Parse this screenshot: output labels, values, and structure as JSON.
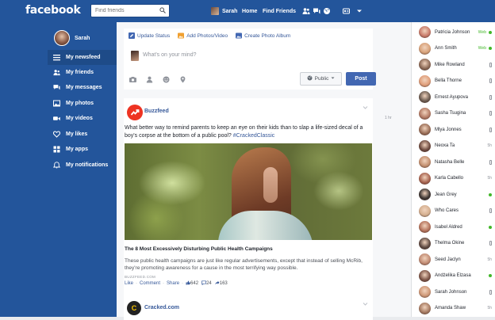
{
  "topbar": {
    "logo": "facebook",
    "search_placeholder": "Find friends",
    "user_name": "Sarah",
    "home": "Home",
    "find_friends": "Find Friends"
  },
  "sidebar": {
    "user_name": "Sarah",
    "items": [
      {
        "label": "My newsfeed",
        "icon": "list-icon"
      },
      {
        "label": "My friends",
        "icon": "friends-icon"
      },
      {
        "label": "My messages",
        "icon": "messages-icon"
      },
      {
        "label": "My photos",
        "icon": "photo-icon"
      },
      {
        "label": "My videos",
        "icon": "video-icon"
      },
      {
        "label": "My likes",
        "icon": "heart-icon"
      },
      {
        "label": "My apps",
        "icon": "apps-icon"
      },
      {
        "label": "My notifications",
        "icon": "bell-icon"
      }
    ]
  },
  "composer": {
    "tabs": [
      "Update Status",
      "Add Photos/Video",
      "Create Photo Album"
    ],
    "placeholder": "What's on your mind?",
    "privacy": "Public",
    "post_label": "Post"
  },
  "post": {
    "author": "Buzzfeed",
    "text": "What better way to remind parents to keep an eye on their kids than to slap a life-sized decal of a boy's corpse at the bottom of a public pool?",
    "hashtag": "#CrackedClassic",
    "link_title": "The 8 Most Excessively Disturbing Public Health Campaigns",
    "link_desc": "These public health campaigns are just like regular advertisements, except that instead of selling McRib, they're promoting awareness for a cause in the most terrifying way possible.",
    "link_domain": "BUZZFEED.COM",
    "like": "Like",
    "comment": "Comment",
    "share": "Share",
    "likes_count": "642",
    "comments_count": "24",
    "shares_count": "163",
    "time": "1 hr"
  },
  "post2": {
    "author": "Cracked.com",
    "logo_letter": "C"
  },
  "chat": [
    {
      "name": "Patricia Johnson",
      "status": "Web",
      "online": true,
      "color": "#c97b6a"
    },
    {
      "name": "Ann Smith",
      "status": "Web",
      "online": true,
      "color": "#d8a27a"
    },
    {
      "name": "Mike Rowland",
      "status": "",
      "online": false,
      "color": "#8c6a57"
    },
    {
      "name": "Bella Thorne",
      "status": "",
      "online": false,
      "color": "#e09e7a"
    },
    {
      "name": "Ernest Ayupova",
      "status": "",
      "online": false,
      "color": "#6d5d52"
    },
    {
      "name": "Sasha Tsugina",
      "status": "",
      "online": false,
      "color": "#b47c66"
    },
    {
      "name": "Mlya Jonnes",
      "status": "",
      "online": false,
      "color": "#9b6f58"
    },
    {
      "name": "Neoxa Ta",
      "status": "5h",
      "online": false,
      "color": "#6e4b40"
    },
    {
      "name": "Natasha Belle",
      "status": "",
      "online": false,
      "color": "#c49070"
    },
    {
      "name": "Karla Cabello",
      "status": "5h",
      "online": false,
      "color": "#a86450"
    },
    {
      "name": "Jean Grey",
      "status": "",
      "online": true,
      "color": "#3d3633"
    },
    {
      "name": "Who Cares",
      "status": "",
      "online": false,
      "color": "#d5b090"
    },
    {
      "name": "Isabel Aldred",
      "status": "",
      "online": true,
      "color": "#b5735c"
    },
    {
      "name": "Thelma Okine",
      "status": "",
      "online": false,
      "color": "#5f4a42"
    },
    {
      "name": "Seed Jaclyn",
      "status": "5h",
      "online": false,
      "color": "#c28c74"
    },
    {
      "name": "Andżelika Elzasa",
      "status": "",
      "online": true,
      "color": "#7d5548"
    },
    {
      "name": "Sarah Johnson",
      "status": "",
      "online": false,
      "color": "#cf9877"
    },
    {
      "name": "Amanda Shaw",
      "status": "5h",
      "online": false,
      "color": "#a77b62"
    }
  ]
}
